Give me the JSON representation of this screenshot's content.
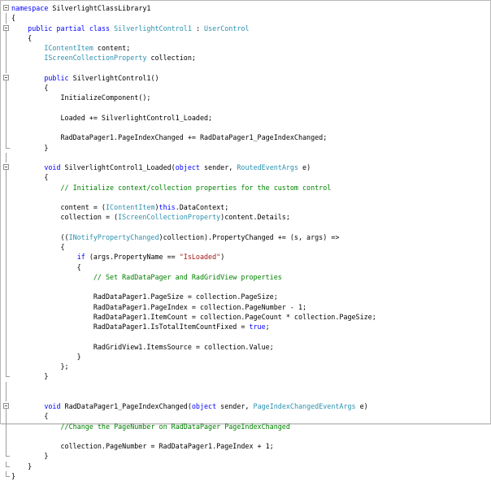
{
  "code": {
    "lines": [
      {
        "text": "namespace SilverlightClassLibrary1",
        "outline": "box",
        "tokens": [
          {
            "t": "namespace",
            "c": "kw"
          },
          {
            "t": " SilverlightClassLibrary1",
            "c": "pl"
          }
        ]
      },
      {
        "text": "{",
        "outline": "line",
        "tokens": [
          {
            "t": "{",
            "c": "pl"
          }
        ]
      },
      {
        "text": "    public partial class SilverlightControl1 : UserControl",
        "outline": "box",
        "tokens": [
          {
            "t": "    ",
            "c": "pl"
          },
          {
            "t": "public",
            "c": "kw"
          },
          {
            "t": " ",
            "c": "pl"
          },
          {
            "t": "partial",
            "c": "kw"
          },
          {
            "t": " ",
            "c": "pl"
          },
          {
            "t": "class",
            "c": "kw"
          },
          {
            "t": " ",
            "c": "pl"
          },
          {
            "t": "SilverlightControl1",
            "c": "ty"
          },
          {
            "t": " : ",
            "c": "pl"
          },
          {
            "t": "UserControl",
            "c": "ty"
          }
        ]
      },
      {
        "text": "    {",
        "outline": "line",
        "tokens": [
          {
            "t": "    {",
            "c": "pl"
          }
        ]
      },
      {
        "text": "        IContentItem content;",
        "outline": "line",
        "tokens": [
          {
            "t": "        ",
            "c": "pl"
          },
          {
            "t": "IContentItem",
            "c": "ty"
          },
          {
            "t": " content;",
            "c": "pl"
          }
        ]
      },
      {
        "text": "        IScreenCollectionProperty collection;",
        "outline": "line",
        "tokens": [
          {
            "t": "        ",
            "c": "pl"
          },
          {
            "t": "IScreenCollectionProperty",
            "c": "ty"
          },
          {
            "t": " collection;",
            "c": "pl"
          }
        ]
      },
      {
        "text": "",
        "outline": "line",
        "tokens": []
      },
      {
        "text": "        public SilverlightControl1()",
        "outline": "box",
        "tokens": [
          {
            "t": "        ",
            "c": "pl"
          },
          {
            "t": "public",
            "c": "kw"
          },
          {
            "t": " SilverlightControl1()",
            "c": "pl"
          }
        ]
      },
      {
        "text": "        {",
        "outline": "line",
        "tokens": [
          {
            "t": "        {",
            "c": "pl"
          }
        ]
      },
      {
        "text": "            InitializeComponent();",
        "outline": "line",
        "tokens": [
          {
            "t": "            InitializeComponent();",
            "c": "pl"
          }
        ]
      },
      {
        "text": "",
        "outline": "line",
        "tokens": []
      },
      {
        "text": "            Loaded += SilverlightControl1_Loaded;",
        "outline": "line",
        "tokens": [
          {
            "t": "            Loaded += SilverlightControl1_Loaded;",
            "c": "pl"
          }
        ]
      },
      {
        "text": "",
        "outline": "line",
        "tokens": []
      },
      {
        "text": "            RadDataPager1.PageIndexChanged += RadDataPager1_PageIndexChanged;",
        "outline": "line",
        "tokens": [
          {
            "t": "            RadDataPager1.PageIndexChanged += RadDataPager1_PageIndexChanged;",
            "c": "pl"
          }
        ]
      },
      {
        "text": "        }",
        "outline": "end",
        "tokens": [
          {
            "t": "        }",
            "c": "pl"
          }
        ]
      },
      {
        "text": "",
        "outline": "line",
        "tokens": []
      },
      {
        "text": "        void SilverlightControl1_Loaded(object sender, RoutedEventArgs e)",
        "outline": "box",
        "tokens": [
          {
            "t": "        ",
            "c": "pl"
          },
          {
            "t": "void",
            "c": "kw"
          },
          {
            "t": " SilverlightControl1_Loaded(",
            "c": "pl"
          },
          {
            "t": "object",
            "c": "kw"
          },
          {
            "t": " sender, ",
            "c": "pl"
          },
          {
            "t": "RoutedEventArgs",
            "c": "ty"
          },
          {
            "t": " e)",
            "c": "pl"
          }
        ]
      },
      {
        "text": "        {",
        "outline": "line",
        "tokens": [
          {
            "t": "        {",
            "c": "pl"
          }
        ]
      },
      {
        "text": "            // Initialize context/collection properties for the custom control",
        "outline": "line",
        "tokens": [
          {
            "t": "            ",
            "c": "pl"
          },
          {
            "t": "// Initialize context/collection properties for the custom control",
            "c": "cm"
          }
        ]
      },
      {
        "text": "",
        "outline": "line",
        "tokens": []
      },
      {
        "text": "            content = (IContentItem)this.DataContext;",
        "outline": "line",
        "tokens": [
          {
            "t": "            content = (",
            "c": "pl"
          },
          {
            "t": "IContentItem",
            "c": "ty"
          },
          {
            "t": ")",
            "c": "pl"
          },
          {
            "t": "this",
            "c": "kw"
          },
          {
            "t": ".DataContext;",
            "c": "pl"
          }
        ]
      },
      {
        "text": "            collection = (IScreenCollectionProperty)content.Details;",
        "outline": "line",
        "tokens": [
          {
            "t": "            collection = (",
            "c": "pl"
          },
          {
            "t": "IScreenCollectionProperty",
            "c": "ty"
          },
          {
            "t": ")content.Details;",
            "c": "pl"
          }
        ]
      },
      {
        "text": "",
        "outline": "line",
        "tokens": []
      },
      {
        "text": "            ((INotifyPropertyChanged)collection).PropertyChanged += (s, args) =>",
        "outline": "line",
        "tokens": [
          {
            "t": "            ((",
            "c": "pl"
          },
          {
            "t": "INotifyPropertyChanged",
            "c": "ty"
          },
          {
            "t": ")collection).PropertyChanged += (s, args) =>",
            "c": "pl"
          }
        ]
      },
      {
        "text": "            {",
        "outline": "line",
        "tokens": [
          {
            "t": "            {",
            "c": "pl"
          }
        ]
      },
      {
        "text": "                if (args.PropertyName == \"IsLoaded\")",
        "outline": "line",
        "tokens": [
          {
            "t": "                ",
            "c": "pl"
          },
          {
            "t": "if",
            "c": "kw"
          },
          {
            "t": " (args.PropertyName == ",
            "c": "pl"
          },
          {
            "t": "\"IsLoaded\"",
            "c": "st"
          },
          {
            "t": ")",
            "c": "pl"
          }
        ]
      },
      {
        "text": "                {",
        "outline": "line",
        "tokens": [
          {
            "t": "                {",
            "c": "pl"
          }
        ]
      },
      {
        "text": "                    // Set RadDataPager and RadGridView properties",
        "outline": "line",
        "tokens": [
          {
            "t": "                    ",
            "c": "pl"
          },
          {
            "t": "// Set RadDataPager and RadGridView properties",
            "c": "cm"
          }
        ]
      },
      {
        "text": "",
        "outline": "line",
        "tokens": []
      },
      {
        "text": "                    RadDataPager1.PageSize = collection.PageSize;",
        "outline": "line",
        "tokens": [
          {
            "t": "                    RadDataPager1.PageSize = collection.PageSize;",
            "c": "pl"
          }
        ]
      },
      {
        "text": "                    RadDataPager1.PageIndex = collection.PageNumber - 1;",
        "outline": "line",
        "tokens": [
          {
            "t": "                    RadDataPager1.PageIndex = collection.PageNumber - 1;",
            "c": "pl"
          }
        ]
      },
      {
        "text": "                    RadDataPager1.ItemCount = collection.PageCount * collection.PageSize;",
        "outline": "line",
        "tokens": [
          {
            "t": "                    RadDataPager1.ItemCount = collection.PageCount * collection.PageSize;",
            "c": "pl"
          }
        ]
      },
      {
        "text": "                    RadDataPager1.IsTotalItemCountFixed = true;",
        "outline": "line",
        "tokens": [
          {
            "t": "                    RadDataPager1.IsTotalItemCountFixed = ",
            "c": "pl"
          },
          {
            "t": "true",
            "c": "kw"
          },
          {
            "t": ";",
            "c": "pl"
          }
        ]
      },
      {
        "text": "",
        "outline": "line",
        "tokens": []
      },
      {
        "text": "                    RadGridView1.ItemsSource = collection.Value;",
        "outline": "line",
        "tokens": [
          {
            "t": "                    RadGridView1.ItemsSource = collection.Value;",
            "c": "pl"
          }
        ]
      },
      {
        "text": "                }",
        "outline": "line",
        "tokens": [
          {
            "t": "                }",
            "c": "pl"
          }
        ]
      },
      {
        "text": "            };",
        "outline": "line",
        "tokens": [
          {
            "t": "            };",
            "c": "pl"
          }
        ]
      },
      {
        "text": "        }",
        "outline": "end",
        "tokens": [
          {
            "t": "        }",
            "c": "pl"
          }
        ]
      },
      {
        "text": "",
        "outline": "line",
        "tokens": []
      },
      {
        "text": "",
        "outline": "line",
        "tokens": []
      },
      {
        "text": "        void RadDataPager1_PageIndexChanged(object sender, PageIndexChangedEventArgs e)",
        "outline": "box",
        "tokens": [
          {
            "t": "        ",
            "c": "pl"
          },
          {
            "t": "void",
            "c": "kw"
          },
          {
            "t": " RadDataPager1_PageIndexChanged(",
            "c": "pl"
          },
          {
            "t": "object",
            "c": "kw"
          },
          {
            "t": " sender, ",
            "c": "pl"
          },
          {
            "t": "PageIndexChangedEventArgs",
            "c": "ty"
          },
          {
            "t": " e)",
            "c": "pl"
          }
        ]
      },
      {
        "text": "        {",
        "outline": "line",
        "tokens": [
          {
            "t": "        {",
            "c": "pl"
          }
        ]
      },
      {
        "text": "            //Change the PageNumber on RadDataPager PageIndexChanged",
        "outline": "line",
        "tokens": [
          {
            "t": "            ",
            "c": "pl"
          },
          {
            "t": "//Change the PageNumber on RadDataPager PageIndexChanged",
            "c": "cm"
          }
        ]
      },
      {
        "text": "",
        "outline": "line",
        "tokens": []
      },
      {
        "text": "            collection.PageNumber = RadDataPager1.PageIndex + 1;",
        "outline": "line",
        "tokens": [
          {
            "t": "            collection.PageNumber = RadDataPager1.PageIndex + 1;",
            "c": "pl"
          }
        ]
      },
      {
        "text": "        }",
        "outline": "end",
        "tokens": [
          {
            "t": "        }",
            "c": "pl"
          }
        ]
      },
      {
        "text": "    }",
        "outline": "end",
        "tokens": [
          {
            "t": "    }",
            "c": "pl"
          }
        ]
      },
      {
        "text": "}",
        "outline": "end",
        "tokens": [
          {
            "t": "}",
            "c": "pl"
          }
        ]
      }
    ]
  },
  "colors": {
    "keyword": "#0000ff",
    "type": "#2b91af",
    "string": "#a31515",
    "comment": "#008000",
    "text": "#000000",
    "background": "#ffffff"
  }
}
